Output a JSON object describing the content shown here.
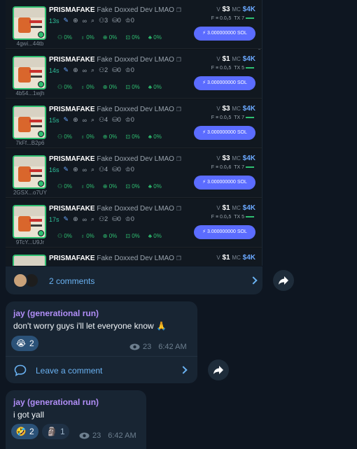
{
  "tokens": [
    {
      "ticker": "PRISMAFAKE",
      "name": "Fake Doxxed Dev LMAO",
      "age": "13s",
      "holders": "3",
      "bundles": "0",
      "devs": "0",
      "address": "4gwi...44tb",
      "vol": "$3",
      "mc": "$4K",
      "fee": "0.0₂5",
      "tx": "7",
      "buy": "3.000000000 SOL",
      "stats": [
        "0%",
        "0%",
        "0%",
        "0%",
        "0%"
      ]
    },
    {
      "ticker": "PRISMAFAKE",
      "name": "Fake Doxxed Dev LMAO",
      "age": "14s",
      "holders": "2",
      "bundles": "0",
      "devs": "0",
      "address": "4b54...1wjh",
      "vol": "$1",
      "mc": "$4K",
      "fee": "0.0₂5",
      "tx": "5",
      "buy": "3.000000000 SOL",
      "stats": [
        "0%",
        "0%",
        "0%",
        "0%",
        "0%"
      ]
    },
    {
      "ticker": "PRISMAFAKE",
      "name": "Fake Doxxed Dev LMAO",
      "age": "15s",
      "holders": "4",
      "bundles": "0",
      "devs": "0",
      "address": "7kFf...B2p6",
      "vol": "$3",
      "mc": "$4K",
      "fee": "0.0₂5",
      "tx": "7",
      "buy": "3.000000000 SOL",
      "stats": [
        "0%",
        "0%",
        "0%",
        "0%",
        "0%"
      ]
    },
    {
      "ticker": "PRISMAFAKE",
      "name": "Fake Doxxed Dev LMAO",
      "age": "16s",
      "holders": "4",
      "bundles": "0",
      "devs": "0",
      "address": "2GSX...o7UY",
      "vol": "$3",
      "mc": "$4K",
      "fee": "0.0₂6",
      "tx": "7",
      "buy": "3.000000000 SOL",
      "stats": [
        "0%",
        "0%",
        "0%",
        "0%",
        "0%"
      ]
    },
    {
      "ticker": "PRISMAFAKE",
      "name": "Fake Doxxed Dev LMAO",
      "age": "17s",
      "holders": "2",
      "bundles": "0",
      "devs": "0",
      "address": "9TcY...U9Jr",
      "vol": "$1",
      "mc": "$4K",
      "fee": "0.0₂5",
      "tx": "5",
      "buy": "3.000000000 SOL",
      "stats": [
        "0%",
        "0%",
        "0%",
        "0%",
        "0%"
      ]
    },
    {
      "ticker": "PRISMAFAKE",
      "name": "Fake Doxxed Dev LMAO",
      "age": "",
      "holders": "",
      "bundles": "",
      "devs": "",
      "address": "",
      "vol": "$1",
      "mc": "$4K",
      "fee": "",
      "tx": "",
      "buy": "",
      "stats": []
    }
  ],
  "labels": {
    "vol_prefix": "V",
    "mc_prefix": "MC",
    "fee_prefix": "F ≡",
    "tx_prefix": "TX"
  },
  "post": {
    "comments_label": "2 comments"
  },
  "messages": [
    {
      "author": "jay (generational run)",
      "text": "don't worry guys i'll let everyone know 🙏",
      "reaction_emoji": "😭",
      "reaction_count": "2",
      "views": "23",
      "time": "6:42 AM",
      "leave_comment": "Leave a comment"
    },
    {
      "author": "jay (generational run)",
      "text": "i got yall",
      "reaction_emoji": "🤣",
      "reaction_count": "2",
      "reaction2_emoji": "🗿",
      "reaction2_count": "1",
      "views": "23",
      "time": "6:42 AM"
    }
  ],
  "colors": {
    "accent": "#6ab2f2",
    "author": "#b18ef7",
    "bubble": "#182533",
    "bg": "#0e1621",
    "buy": "#5b6cff",
    "green": "#2fbf71"
  }
}
